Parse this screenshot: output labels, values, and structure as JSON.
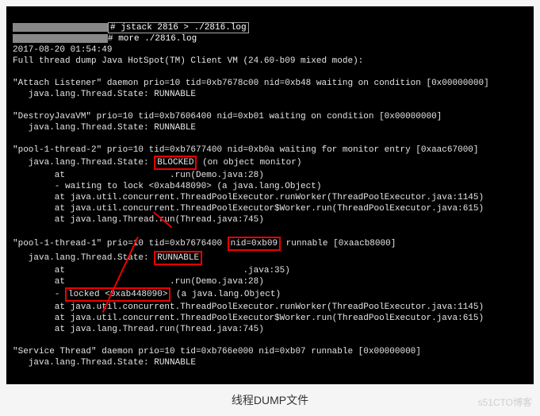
{
  "terminal": {
    "cmd1": "# jstack 2816 > ./2816.log",
    "cmd2": "# more ./2816.log",
    "ts": "2017-08-20 01:54:49",
    "header": "Full thread dump Java HotSpot(TM) Client VM (24.60-b09 mixed mode):",
    "attach1": "\"Attach Listener\" daemon prio=10 tid=0xb7678c00 nid=0xb48 waiting on condition [0x00000000]",
    "attach2": "   java.lang.Thread.State: RUNNABLE",
    "destroy1": "\"DestroyJavaVM\" prio=10 tid=0xb7606400 nid=0xb01 waiting on condition [0x00000000]",
    "destroy2": "   java.lang.Thread.State: RUNNABLE",
    "p2_l1a": "\"pool-1-thread-2\" prio=10 tid=0xb7677400 nid=0xb0a waiting for monitor entry [0xaac67000]",
    "p2_l2a": "   java.lang.Thread.State: ",
    "p2_blocked": "BLOCKED",
    "p2_l2b": "(on object monitor)",
    "p2_l3": "        at                    .run(Demo.java:28)",
    "p2_l4": "        - waiting to lock <0xab448090> (a java.lang.Object)",
    "p2_l5": "        at java.util.concurrent.ThreadPoolExecutor.runWorker(ThreadPoolExecutor.java:1145)",
    "p2_l6": "        at java.util.concurrent.ThreadPoolExecutor$Worker.run(ThreadPoolExecutor.java:615)",
    "p2_l7": "        at java.lang.Thread.run(Thread.java:745)",
    "p1_l1a": "\"pool-1-thread-1\" prio=10 tid=0xb7676400 ",
    "p1_nid": "nid=0xb09",
    "p1_l1b": " runnable [0xaacb8000]",
    "p1_l2a": "   java.lang.Thread.State: ",
    "p1_runnable": "RUNNABLE",
    "p1_l3": "        at                                  .java:35)",
    "p1_l4": "        at                    .run(Demo.java:28)",
    "p1_l5a": "        - ",
    "p1_locked": "locked <0xab448090>",
    "p1_l5b": " (a java.lang.Object)",
    "p1_l6": "        at java.util.concurrent.ThreadPoolExecutor.runWorker(ThreadPoolExecutor.java:1145)",
    "p1_l7": "        at java.util.concurrent.ThreadPoolExecutor$Worker.run(ThreadPoolExecutor.java:615)",
    "p1_l8": "        at java.lang.Thread.run(Thread.java:745)",
    "svc1": "\"Service Thread\" daemon prio=10 tid=0xb766e000 nid=0xb07 runnable [0x00000000]",
    "svc2": "   java.lang.Thread.State: RUNNABLE"
  },
  "caption": "线程DUMP文件",
  "watermark": "s51CTO博客"
}
